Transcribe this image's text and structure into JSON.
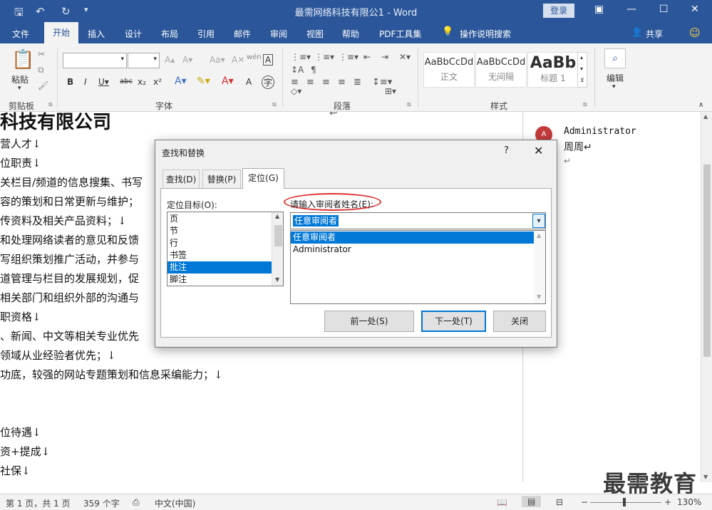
{
  "title_bar": {
    "doc_title": "最需网络科技有限公1 - Word",
    "login": "登录"
  },
  "tabs": [
    "文件",
    "开始",
    "插入",
    "设计",
    "布局",
    "引用",
    "邮件",
    "审阅",
    "视图",
    "帮助",
    "PDF工具集",
    "操作说明搜索"
  ],
  "share": "共享",
  "ribbon": {
    "clipboard_label": "剪贴板",
    "paste": "粘贴",
    "font_label": "字体",
    "paragraph_label": "段落",
    "styles_label": "样式",
    "styles": [
      {
        "preview": "AaBbCcDd",
        "name": "正文"
      },
      {
        "preview": "AaBbCcDd",
        "name": "无间隔"
      },
      {
        "preview": "AaBb",
        "name": "标题 1"
      }
    ],
    "edit": "编辑"
  },
  "document": {
    "heading": "科技有限公司",
    "lines": [
      "营人才↓",
      "位职责↓",
      "关栏目/频道的信息搜集、书写",
      "容的策划和日常更新与维护；",
      "传资料及相关产品资料；↓",
      "和处理网络读者的意见和反馈",
      "写组织策划推广活动，并参与",
      "道管理与栏目的发展规划，促",
      "相关部门和组织外部的沟通与",
      "职资格↓",
      "、新闻、中文等相关专业优先",
      "领域从业经验者优先；↓",
      "功底，较强的网站专题策划和信息采编能力；↓",
      "",
      "",
      "位待遇↓",
      "资+提成↓",
      "社保↓"
    ]
  },
  "comment": {
    "avatar": "A",
    "author": "Administrator",
    "text": "周周↵",
    "mark": "↵"
  },
  "watermark": "最需教育",
  "status": {
    "page": "第 1 页，共 1 页",
    "words": "359 个字",
    "lang": "中文(中国)",
    "zoom": "130%"
  },
  "dialog": {
    "title": "查找和替换",
    "help": "?",
    "close": "✕",
    "tabs": [
      "查找(D)",
      "替换(P)",
      "定位(G)"
    ],
    "goto_label": "定位目标(O):",
    "goto_items": [
      "页",
      "节",
      "行",
      "书签",
      "批注",
      "脚注"
    ],
    "reviewer_label": "请输入审阅者姓名(E):",
    "reviewer_value": "任意审阅者",
    "reviewer_items": [
      "任意审阅者",
      "Administrator"
    ],
    "btn_prev": "前一处(S)",
    "btn_next": "下一处(T)",
    "btn_close": "关闭"
  }
}
